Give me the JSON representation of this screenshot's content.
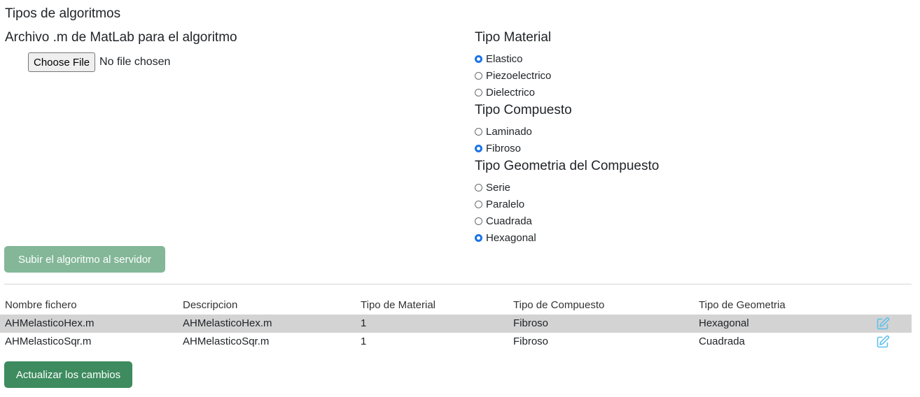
{
  "page": {
    "title": "Tipos de algoritmos"
  },
  "upload": {
    "file_label": "Archivo .m de MatLab para el algoritmo",
    "choose_button": "Choose File",
    "file_status": "No file chosen",
    "submit_label": "Subir el algoritmo al servidor"
  },
  "material": {
    "title": "Tipo Material",
    "options": [
      {
        "label": "Elastico",
        "checked": true
      },
      {
        "label": "Piezoelectrico",
        "checked": false
      },
      {
        "label": "Dielectrico",
        "checked": false
      }
    ]
  },
  "compuesto": {
    "title": "Tipo Compuesto",
    "options": [
      {
        "label": "Laminado",
        "checked": false
      },
      {
        "label": "Fibroso",
        "checked": true
      }
    ]
  },
  "geometria": {
    "title": "Tipo Geometria del Compuesto",
    "options": [
      {
        "label": "Serie",
        "checked": false
      },
      {
        "label": "Paralelo",
        "checked": false
      },
      {
        "label": "Cuadrada",
        "checked": false
      },
      {
        "label": "Hexagonal",
        "checked": true
      }
    ]
  },
  "table": {
    "headers": [
      "Nombre fichero",
      "Descripcion",
      "Tipo de Material",
      "Tipo de Compuesto",
      "Tipo de Geometria"
    ],
    "rows": [
      [
        "AHMelasticoHex.m",
        "AHMelasticoHex.m",
        "1",
        "Fibroso",
        "Hexagonal"
      ],
      [
        "AHMelasticoSqr.m",
        "AHMelasticoSqr.m",
        "1",
        "Fibroso",
        "Cuadrada"
      ]
    ]
  },
  "actions": {
    "save_label": "Actualizar los cambios"
  },
  "colors": {
    "primary_green": "#3d8b5e",
    "disabled_green": "#83b798",
    "radio_blue": "#1a73e8",
    "edit_icon": "#5bc0eb"
  }
}
